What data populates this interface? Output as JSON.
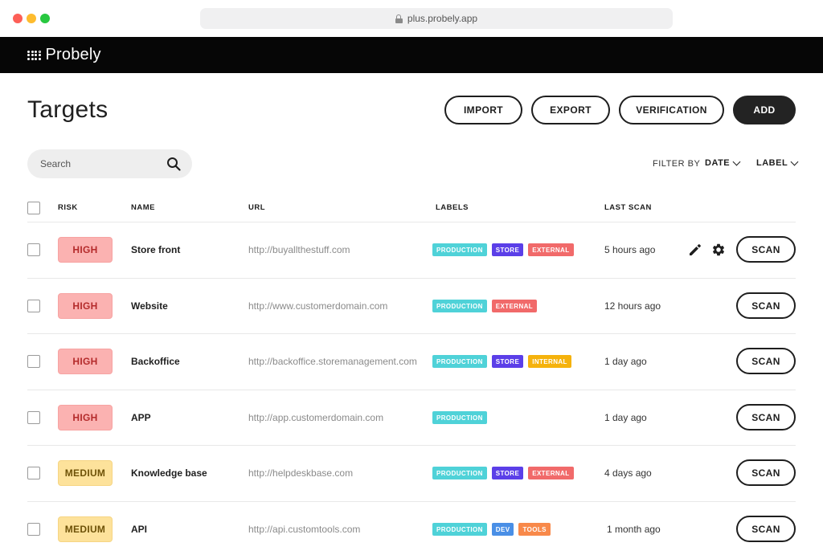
{
  "browser": {
    "url": "plus.probely.app"
  },
  "app": {
    "brand": "Probely"
  },
  "page": {
    "title": "Targets",
    "actions": {
      "import": "IMPORT",
      "export": "EXPORT",
      "verification": "VERIFICATION",
      "add": "ADD"
    }
  },
  "search": {
    "placeholder": "Search"
  },
  "filters": {
    "label": "FILTER BY",
    "date": "DATE",
    "label_filter": "LABEL"
  },
  "table": {
    "headers": {
      "risk": "RISK",
      "name": "NAME",
      "url": "URL",
      "labels": "LABELS",
      "last_scan": "LAST SCAN"
    },
    "scan_label": "SCAN",
    "rows": [
      {
        "risk": "HIGH",
        "risk_level": "high",
        "name": "Store front",
        "url": "http://buyallthestuff.com",
        "labels": [
          {
            "text": "PRODUCTION",
            "color": "#4fd2d8"
          },
          {
            "text": "STORE",
            "color": "#5b3fe8"
          },
          {
            "text": "EXTERNAL",
            "color": "#f16a6a"
          }
        ],
        "last_scan": "5 hours ago",
        "scan": "SCAN"
      },
      {
        "risk": "HIGH",
        "risk_level": "high",
        "name": "Website",
        "url": "http://www.customerdomain.com",
        "labels": [
          {
            "text": "PRODUCTION",
            "color": "#4fd2d8"
          },
          {
            "text": "EXTERNAL",
            "color": "#f16a6a"
          }
        ],
        "last_scan": "12 hours ago",
        "scan": "SCAN"
      },
      {
        "risk": "HIGH",
        "risk_level": "high",
        "name": "Backoffice",
        "url": "http://backoffice.storemanagement.com",
        "labels": [
          {
            "text": "PRODUCTION",
            "color": "#4fd2d8"
          },
          {
            "text": "STORE",
            "color": "#5b3fe8"
          },
          {
            "text": "INTERNAL",
            "color": "#f5b20c"
          }
        ],
        "last_scan": "1 day ago",
        "scan": "SCAN"
      },
      {
        "risk": "HIGH",
        "risk_level": "high",
        "name": "APP",
        "url": "http://app.customerdomain.com",
        "labels": [
          {
            "text": "PRODUCTION",
            "color": "#4fd2d8"
          }
        ],
        "last_scan": "1 day ago",
        "scan": "SCAN"
      },
      {
        "risk": "MEDIUM",
        "risk_level": "medium",
        "name": "Knowledge base",
        "url": "http://helpdeskbase.com",
        "labels": [
          {
            "text": "PRODUCTION",
            "color": "#4fd2d8"
          },
          {
            "text": "STORE",
            "color": "#5b3fe8"
          },
          {
            "text": "EXTERNAL",
            "color": "#f16a6a"
          }
        ],
        "last_scan": "4 days ago",
        "scan": "SCAN"
      },
      {
        "risk": "MEDIUM",
        "risk_level": "medium",
        "name": "API",
        "url": "http://api.customtools.com",
        "labels": [
          {
            "text": "PRODUCTION",
            "color": "#4fd2d8"
          },
          {
            "text": "DEV",
            "color": "#4a8fe6"
          },
          {
            "text": "TOOLS",
            "color": "#f8894a"
          }
        ],
        "last_scan": "1 month ago",
        "scan": "SCAN"
      }
    ]
  }
}
